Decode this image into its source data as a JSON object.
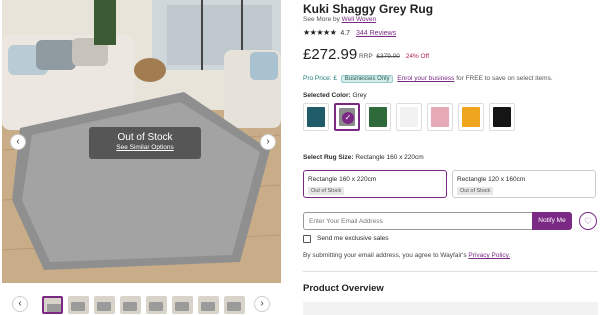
{
  "product": {
    "title": "Kuki Shaggy Grey Rug",
    "see_more_prefix": "See More by",
    "brand": "Well Woven",
    "stars": "★★★★★",
    "rating": "4.7",
    "reviews": "344 Reviews",
    "price": "£272.99",
    "rrp_label": "RRP",
    "rrp_value": "£379.00",
    "discount": "24% Off"
  },
  "pro": {
    "label": "Pro Price: £",
    "badge": "Businesses Only",
    "link": "Enrol your business",
    "suffix": "for FREE to save on select items."
  },
  "color": {
    "label": "Selected Color:",
    "value": "Grey",
    "swatches": [
      {
        "name": "teal",
        "hex": "#1f5b68"
      },
      {
        "name": "grey",
        "hex": "#8c8c8c",
        "selected": true
      },
      {
        "name": "green",
        "hex": "#2f6b3a"
      },
      {
        "name": "white",
        "hex": "#f2f2f2"
      },
      {
        "name": "pink",
        "hex": "#e7a9b5"
      },
      {
        "name": "yellow",
        "hex": "#f0a51e"
      },
      {
        "name": "black",
        "hex": "#151515"
      }
    ]
  },
  "size": {
    "label": "Select Rug Size:",
    "value": "Rectangle 160 x 220cm",
    "options": [
      {
        "label": "Rectangle 160 x 220cm",
        "status": "Out of Stock"
      },
      {
        "label": "Rectangle 120 x 160cm",
        "status": "Out of Stock"
      }
    ]
  },
  "notify": {
    "placeholder": "Enter Your Email Address",
    "button": "Notify Me",
    "checkbox_label": "Send me exclusive sales",
    "disclaimer_prefix": "By submitting your email address, you agree to Wayfair's",
    "privacy_link": "Privacy Policy."
  },
  "gallery": {
    "out_of_stock": "Out of Stock",
    "see_similar": "See Similar Options",
    "prev_icon": "‹",
    "next_icon": "›"
  },
  "overview": {
    "heading": "Product Overview"
  },
  "colors": {
    "accent": "#7a2a85",
    "discount": "#b0244c"
  }
}
